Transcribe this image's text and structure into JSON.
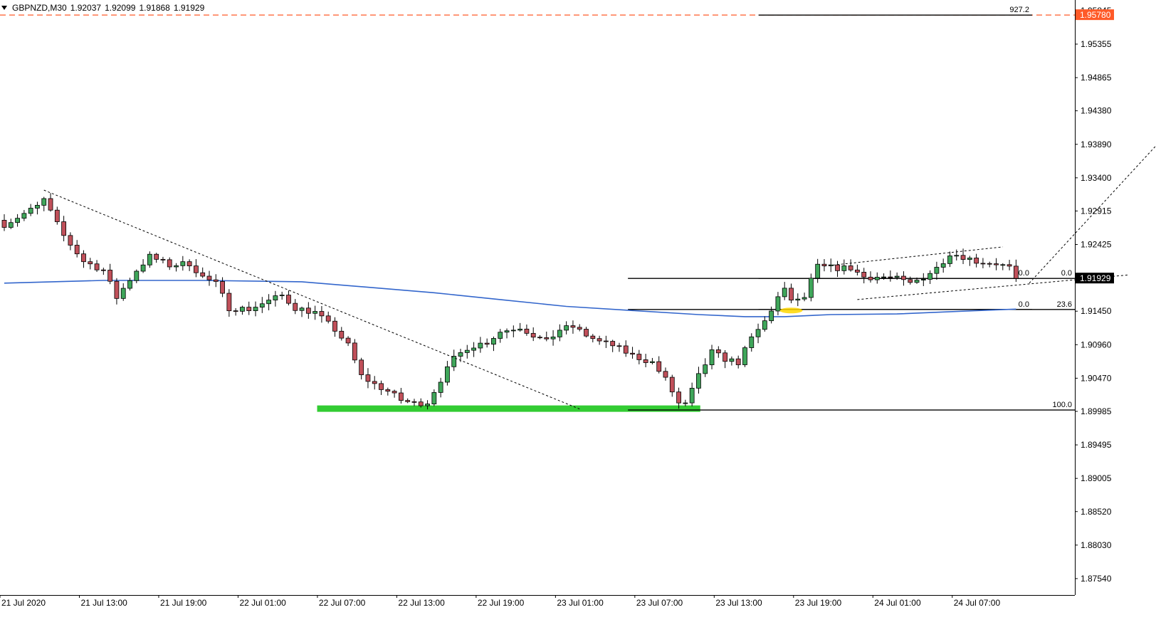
{
  "header": {
    "symbol": "GBPNZD,M30",
    "open": "1.92037",
    "high": "1.92099",
    "low": "1.91868",
    "close": "1.91929"
  },
  "colors": {
    "bull": "#3fa65a",
    "bear": "#c0505a",
    "ma": "#3366cc",
    "support_zone": "#33cc33",
    "target_line": "#ff5a28",
    "highlight": "#ffd700"
  },
  "chart_data": {
    "type": "candlestick",
    "symbol": "GBPNZD",
    "timeframe": "M30",
    "ylim": [
      1.873,
      1.96
    ],
    "y_ticks": [
      "1.95845",
      "1.95355",
      "1.94865",
      "1.94380",
      "1.93890",
      "1.93400",
      "1.92915",
      "1.92425",
      "1.91450",
      "1.90960",
      "1.90470",
      "1.89985",
      "1.89495",
      "1.89005",
      "1.88520",
      "1.88030",
      "1.87540"
    ],
    "x_ticks": [
      "21 Jul 2020",
      "21 Jul 13:00",
      "21 Jul 19:00",
      "22 Jul 01:00",
      "22 Jul 07:00",
      "22 Jul 13:00",
      "22 Jul 19:00",
      "23 Jul 01:00",
      "23 Jul 07:00",
      "23 Jul 13:00",
      "23 Jul 19:00",
      "24 Jul 01:00",
      "24 Jul 07:00"
    ],
    "x_tick_bars": [
      0,
      12,
      24,
      36,
      48,
      60,
      72,
      84,
      96,
      108,
      120,
      132,
      144
    ],
    "current_price": "1.91929",
    "target_price": "1.95780",
    "close_path": [
      [
        0,
        1.9272
      ],
      [
        5,
        1.9298
      ],
      [
        6,
        1.9308
      ],
      [
        8,
        1.9272
      ],
      [
        9,
        1.9255
      ],
      [
        12,
        1.9218
      ],
      [
        15,
        1.9205
      ],
      [
        17,
        1.9165
      ],
      [
        20,
        1.9205
      ],
      [
        22,
        1.9225
      ],
      [
        25,
        1.9212
      ],
      [
        28,
        1.9215
      ],
      [
        30,
        1.9195
      ],
      [
        32,
        1.9185
      ],
      [
        34,
        1.915
      ],
      [
        37,
        1.9148
      ],
      [
        40,
        1.916
      ],
      [
        42,
        1.9168
      ],
      [
        44,
        1.915
      ],
      [
        47,
        1.9143
      ],
      [
        50,
        1.9118
      ],
      [
        52,
        1.9095
      ],
      [
        54,
        1.905
      ],
      [
        56,
        1.9038
      ],
      [
        58,
        1.9028
      ],
      [
        60,
        1.9015
      ],
      [
        62,
        1.901
      ],
      [
        64,
        1.9012
      ],
      [
        66,
        1.9045
      ],
      [
        68,
        1.9075
      ],
      [
        70,
        1.9092
      ],
      [
        73,
        1.91
      ],
      [
        75,
        1.9115
      ],
      [
        78,
        1.9122
      ],
      [
        80,
        1.911
      ],
      [
        82,
        1.91
      ],
      [
        84,
        1.9118
      ],
      [
        86,
        1.9122
      ],
      [
        88,
        1.911
      ],
      [
        90,
        1.91
      ],
      [
        92,
        1.9095
      ],
      [
        95,
        1.908
      ],
      [
        98,
        1.907
      ],
      [
        100,
        1.9045
      ],
      [
        102,
        1.901
      ],
      [
        103,
        1.9008
      ],
      [
        105,
        1.905
      ],
      [
        107,
        1.9085
      ],
      [
        109,
        1.9075
      ],
      [
        111,
        1.907
      ],
      [
        113,
        1.9105
      ],
      [
        115,
        1.913
      ],
      [
        117,
        1.9165
      ],
      [
        118,
        1.9175
      ],
      [
        119,
        1.9162
      ],
      [
        120,
        1.916
      ],
      [
        121,
        1.9165
      ],
      [
        122,
        1.919
      ],
      [
        123,
        1.921
      ],
      [
        126,
        1.9208
      ],
      [
        128,
        1.9208
      ],
      [
        130,
        1.9195
      ],
      [
        133,
        1.9195
      ],
      [
        135,
        1.9192
      ],
      [
        137,
        1.9185
      ],
      [
        139,
        1.9195
      ],
      [
        141,
        1.9208
      ],
      [
        143,
        1.923
      ],
      [
        145,
        1.9225
      ],
      [
        147,
        1.9218
      ],
      [
        150,
        1.9215
      ],
      [
        152,
        1.9208
      ],
      [
        153,
        1.9193
      ]
    ],
    "series": [
      {
        "type": "moving_average",
        "points": [
          [
            0,
            1.9186
          ],
          [
            15,
            1.919
          ],
          [
            30,
            1.919
          ],
          [
            45,
            1.9188
          ],
          [
            55,
            1.918
          ],
          [
            65,
            1.9172
          ],
          [
            75,
            1.9162
          ],
          [
            85,
            1.9152
          ],
          [
            95,
            1.9146
          ],
          [
            105,
            1.914
          ],
          [
            112,
            1.9137
          ],
          [
            118,
            1.9137
          ],
          [
            125,
            1.914
          ],
          [
            135,
            1.9141
          ],
          [
            145,
            1.9145
          ],
          [
            153,
            1.9148
          ]
        ]
      }
    ],
    "fibonacci": [
      {
        "levels": [
          {
            "label": "0.0",
            "price": 1.91929
          },
          {
            "label": "23.6",
            "price": 1.91475
          },
          {
            "label": "100.0",
            "price": 1.90005
          }
        ]
      },
      {
        "levels": [
          {
            "label": "0.0",
            "price": 1.91929
          },
          {
            "label": "0.0",
            "price": 1.91475
          },
          {
            "label": "927.2",
            "price": 1.9578
          }
        ]
      }
    ],
    "support_zone": {
      "price": 1.9002,
      "from_bar": 57,
      "to_bar": 113
    },
    "trendlines": [
      {
        "from": [
          6,
          1.9322
        ],
        "to": [
          87,
          1.9002
        ]
      },
      {
        "from": [
          124,
          1.9211
        ],
        "to": [
          151,
          1.9239
        ]
      },
      {
        "from": [
          129,
          1.9162
        ],
        "to": [
          170,
          1.9198
        ]
      },
      {
        "from": [
          155,
          1.9186
        ],
        "to": [
          192,
          1.9574
        ]
      }
    ],
    "highlight": {
      "bar": 119,
      "price": 1.9146
    }
  }
}
